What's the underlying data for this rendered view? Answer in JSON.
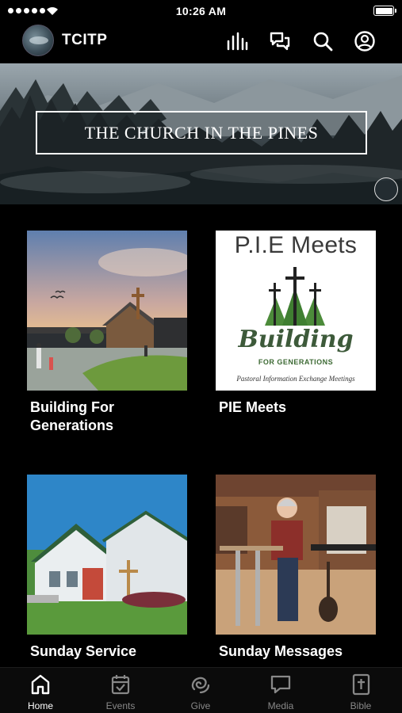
{
  "status_bar": {
    "time": "10:26 AM"
  },
  "header": {
    "title": "TCITP",
    "icons": [
      "stats-icon",
      "chat-icon",
      "search-icon",
      "account-icon"
    ]
  },
  "banner": {
    "text": "THE CHURCH IN THE PINES"
  },
  "cards": [
    {
      "title": "Building For Generations"
    },
    {
      "title": "PIE Meets",
      "image_text": {
        "heading": "P.I.E Meets",
        "logo_word": "Building",
        "logo_tagline": "FOR GENERATIONS",
        "subtitle": "Pastoral Information Exchange Meetings"
      }
    },
    {
      "title": "Sunday Service"
    },
    {
      "title": "Sunday Messages"
    }
  ],
  "tab_bar": {
    "tabs": [
      {
        "label": "Home",
        "icon": "home-icon",
        "active": true
      },
      {
        "label": "Events",
        "icon": "calendar-icon",
        "active": false
      },
      {
        "label": "Give",
        "icon": "give-icon",
        "active": false
      },
      {
        "label": "Media",
        "icon": "media-icon",
        "active": false
      },
      {
        "label": "Bible",
        "icon": "bible-icon",
        "active": false
      }
    ]
  },
  "colors": {
    "background": "#000000",
    "tab_inactive": "#888888",
    "tab_active": "#ffffff"
  }
}
